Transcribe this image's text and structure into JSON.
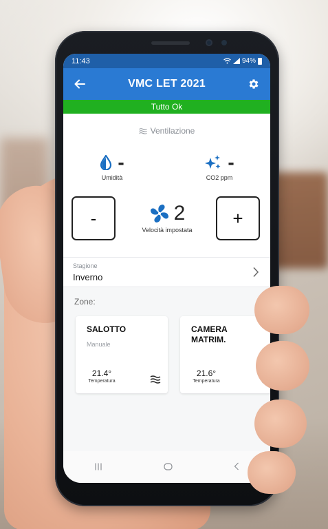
{
  "statusbar": {
    "time": "11:43",
    "battery": "94%"
  },
  "appbar": {
    "title": "VMC LET 2021",
    "back_icon": "back-arrow-icon",
    "settings_icon": "gear-icon"
  },
  "status_strip": {
    "text": "Tutto Ok",
    "color": "#20b020"
  },
  "ventilation": {
    "label": "Ventilazione",
    "icon": "waves-icon"
  },
  "humidity": {
    "value": "-",
    "caption": "Umidità",
    "icon": "drop-icon"
  },
  "co2": {
    "value": "-",
    "caption": "CO2 ppm",
    "icon": "sparkle-icon"
  },
  "speed": {
    "minus_label": "-",
    "plus_label": "+",
    "value": "2",
    "caption": "Velocità impostata",
    "icon": "fan-icon"
  },
  "season": {
    "label": "Stagione",
    "value": "Inverno"
  },
  "zones": {
    "label": "Zone:",
    "items": [
      {
        "name": "SALOTTO",
        "mode": "Manuale",
        "temperature": "21.4°",
        "temp_caption": "Temperatura"
      },
      {
        "name": "CAMERA MATRIM.",
        "mode": "",
        "temperature": "21.6°",
        "temp_caption": "Temperatura"
      }
    ]
  },
  "colors": {
    "appbar": "#2a7ad3",
    "statusbar": "#1f5fa8",
    "ok": "#20b020",
    "accent": "#1b6fc2"
  }
}
